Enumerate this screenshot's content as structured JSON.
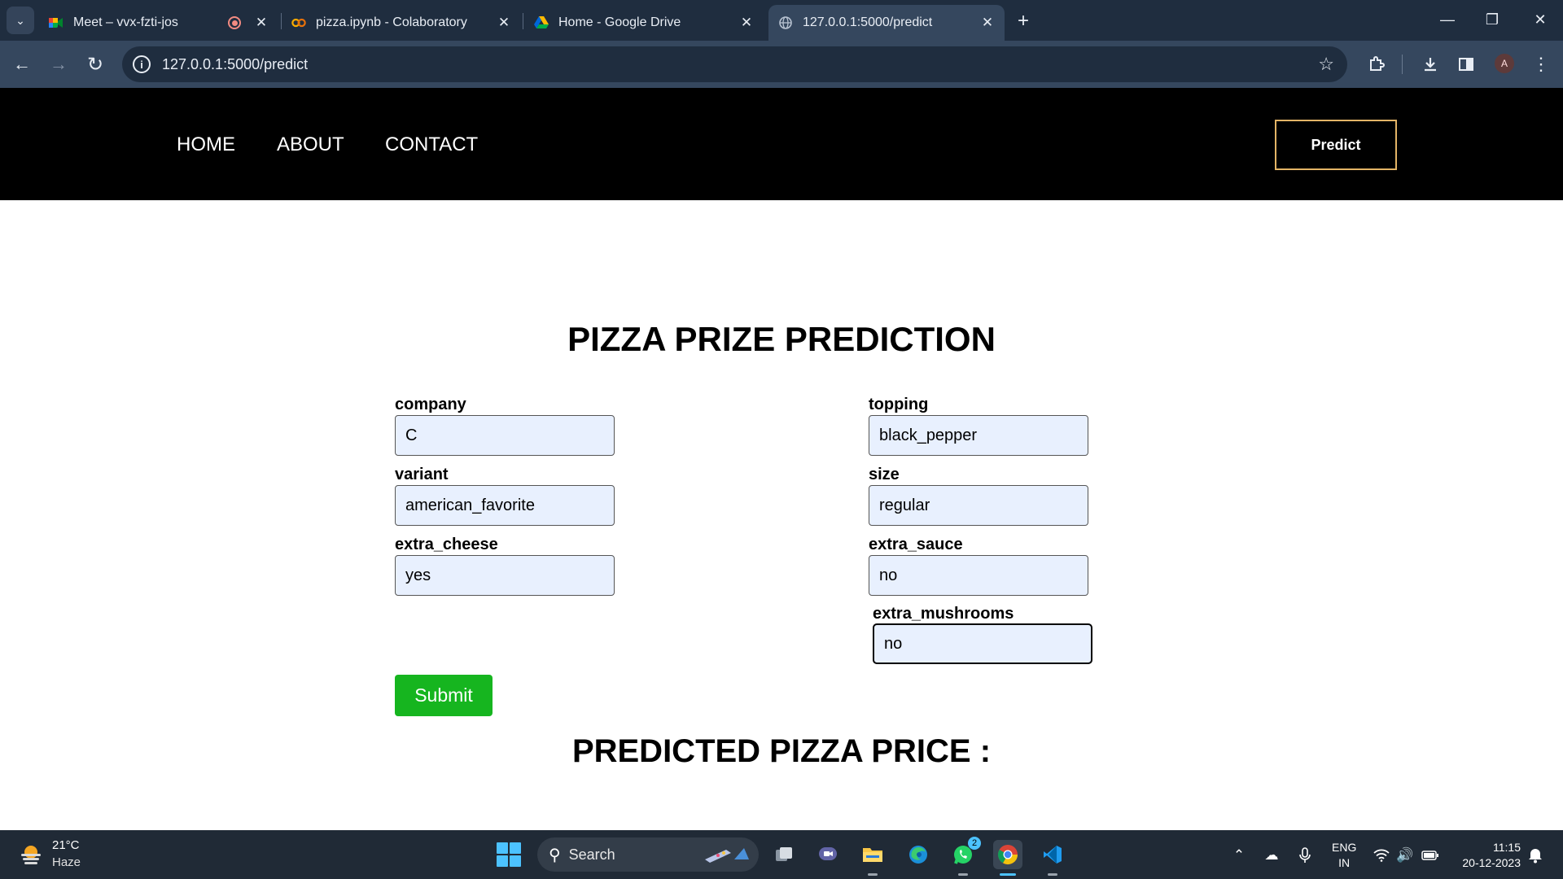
{
  "browser": {
    "tabs": [
      {
        "title": "Meet – vvx-fzti-jos",
        "favicon": "google-meet-icon",
        "recording": true
      },
      {
        "title": "pizza.ipynb - Colaboratory",
        "favicon": "colab-icon"
      },
      {
        "title": "Home - Google Drive",
        "favicon": "google-drive-icon"
      },
      {
        "title": "127.0.0.1:5000/predict",
        "favicon": "globe-icon",
        "active": true
      }
    ],
    "url": "127.0.0.1:5000/predict",
    "profile_initial": "A"
  },
  "site": {
    "nav": {
      "home": "HOME",
      "about": "ABOUT",
      "contact": "CONTACT",
      "predict": "Predict"
    },
    "title": "PIZZA PRIZE PREDICTION",
    "fields": {
      "company": {
        "label": "company",
        "value": "C"
      },
      "topping": {
        "label": "topping",
        "value": "black_pepper"
      },
      "variant": {
        "label": "variant",
        "value": "american_favorite"
      },
      "size": {
        "label": "size",
        "value": "regular"
      },
      "extra_cheese": {
        "label": "extra_cheese",
        "value": "yes"
      },
      "extra_sauce": {
        "label": "extra_sauce",
        "value": "no"
      },
      "extra_mushrooms": {
        "label": "extra_mushrooms",
        "value": "no"
      }
    },
    "submit": "Submit",
    "result_title": "PREDICTED PIZZA PRICE :"
  },
  "taskbar": {
    "weather": {
      "temp": "21°C",
      "desc": "Haze"
    },
    "search_label": "Search",
    "whatsapp_badge": "2",
    "language": {
      "line1": "ENG",
      "line2": "IN"
    },
    "clock": {
      "time": "11:15",
      "date": "20-12-2023"
    }
  },
  "colors": {
    "chrome_dark": "#1f2d3f",
    "chrome_toolbar": "#35475e",
    "nav_bg": "#000000",
    "predict_border": "#e3b466",
    "input_bg": "#e8f0fe",
    "submit_bg": "#16b51f",
    "taskbar_bg": "#202a36"
  }
}
